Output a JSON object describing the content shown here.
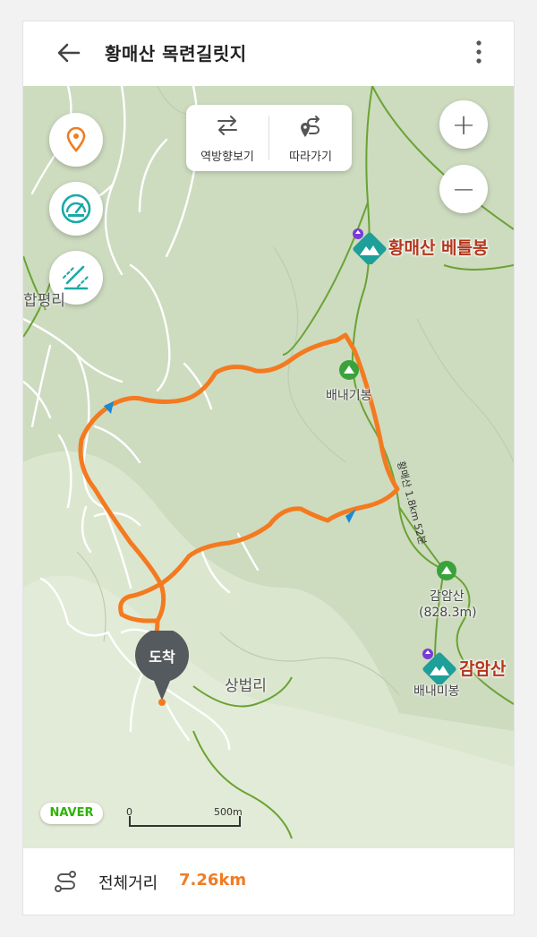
{
  "header": {
    "title": "황매산 목련길릿지"
  },
  "toolbar": {
    "reverse_label": "역방향보기",
    "follow_label": "따라가기"
  },
  "map": {
    "place_labels": [
      "합평리",
      "상법리"
    ],
    "peaks": [
      {
        "name": "배내기봉"
      },
      {
        "name": "감암산",
        "elevation": "(828.3m)"
      },
      {
        "name": "배내미봉"
      }
    ],
    "poi": [
      {
        "name": "황매산 베틀봉"
      },
      {
        "name": "감암산"
      }
    ],
    "trail_text": "황매산 1.8km 52분",
    "arrival_label": "도착",
    "provider_logo": "NAVER",
    "scale": {
      "start": "0",
      "end": "500m"
    },
    "zoom_in": "+",
    "zoom_out": "−",
    "route_color": "#f47a20",
    "trail_color": "#6aa334"
  },
  "footer": {
    "distance_label": "전체거리",
    "distance_value": "7.26km"
  }
}
